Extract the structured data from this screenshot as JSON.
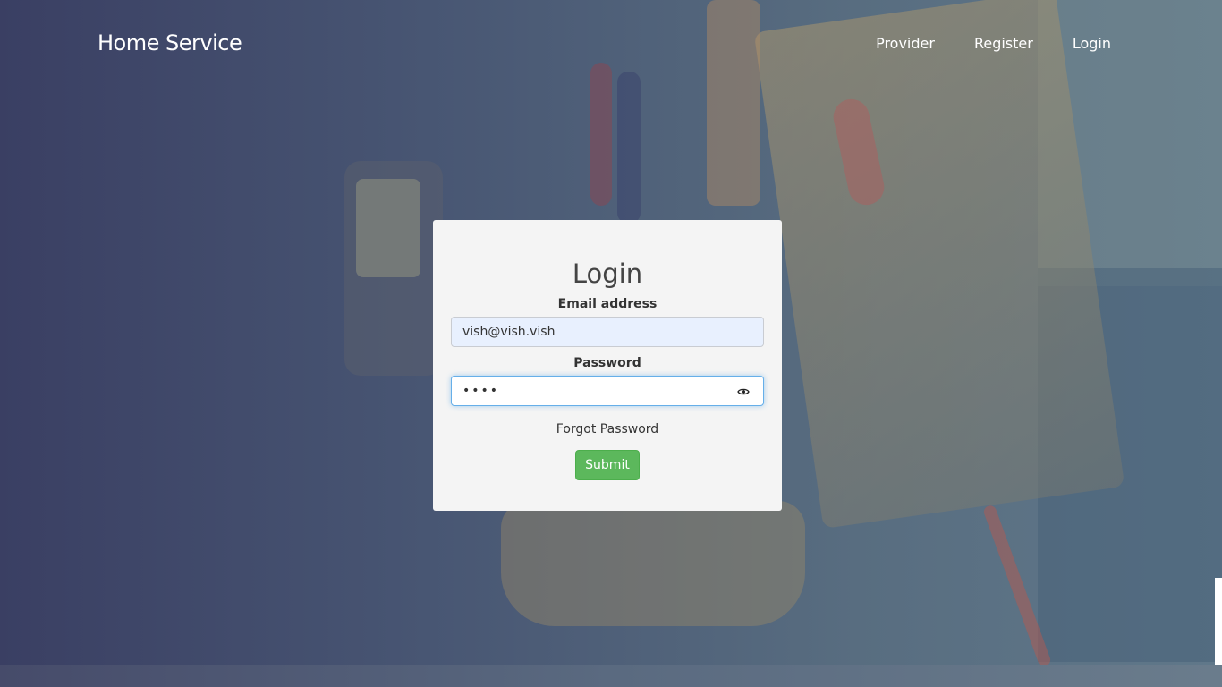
{
  "header": {
    "brand": "Home Service",
    "nav": [
      {
        "label": "Provider"
      },
      {
        "label": "Register"
      },
      {
        "label": "Login"
      }
    ]
  },
  "login_form": {
    "title": "Login",
    "email": {
      "label": "Email address",
      "value": "vish@vish.vish"
    },
    "password": {
      "label": "Password",
      "value": "vish",
      "toggle_icon": "eye-icon"
    },
    "forgot_label": "Forgot Password",
    "submit_label": "Submit"
  },
  "colors": {
    "submit_button": "#5cb85c",
    "card_background": "#f4f4f4",
    "input_focus_border": "#66afe9"
  }
}
